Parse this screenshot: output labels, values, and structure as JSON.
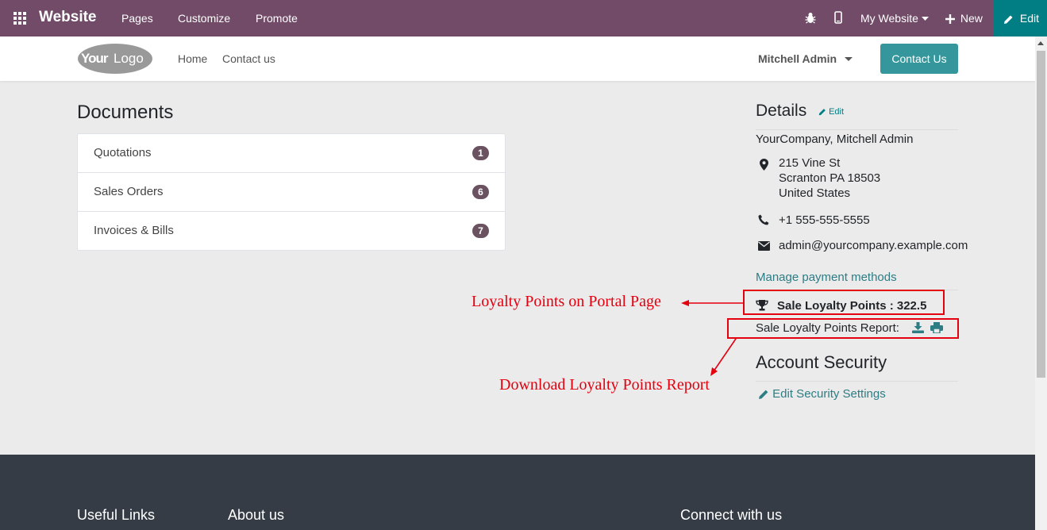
{
  "adminbar": {
    "brand": "Website",
    "menu": [
      "Pages",
      "Customize",
      "Promote"
    ],
    "website_label": "My Website",
    "new_label": "New",
    "edit_label": "Edit"
  },
  "header": {
    "logo_text": "YourLogo",
    "nav": [
      "Home",
      "Contact us"
    ],
    "user": "Mitchell Admin",
    "contact_btn": "Contact Us"
  },
  "documents": {
    "title": "Documents",
    "items": [
      {
        "label": "Quotations",
        "count": "1"
      },
      {
        "label": "Sales Orders",
        "count": "6"
      },
      {
        "label": "Invoices & Bills",
        "count": "7"
      }
    ]
  },
  "details": {
    "title": "Details",
    "edit_label": "Edit",
    "name": "YourCompany, Mitchell Admin",
    "address": [
      "215 Vine St",
      "Scranton PA 18503",
      "United States"
    ],
    "phone": "+1 555-555-5555",
    "email": "admin@yourcompany.example.com",
    "payment_link": "Manage payment methods",
    "loyalty_points": "Sale Loyalty Points : 322.5",
    "report_label": "Sale Loyalty Points Report:"
  },
  "security": {
    "title": "Account Security",
    "edit_link": "Edit Security Settings"
  },
  "annotations": {
    "portal": "Loyalty Points on Portal Page",
    "download": "Download Loyalty Points Report"
  },
  "footer": {
    "headings": [
      "Useful Links",
      "About us",
      "Connect with us"
    ]
  }
}
